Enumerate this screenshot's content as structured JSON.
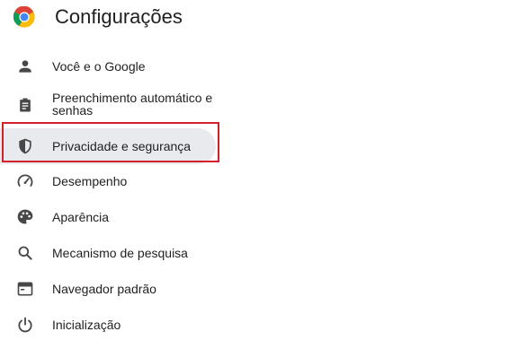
{
  "header": {
    "title": "Configurações",
    "logo_icon": "chrome-logo-icon"
  },
  "sidebar": {
    "items": [
      {
        "label": "Você e o Google",
        "icon": "person-icon"
      },
      {
        "label": "Preenchimento automático e senhas",
        "icon": "clipboard-icon"
      },
      {
        "label": "Privacidade e segurança",
        "icon": "shield-icon",
        "selected": true
      },
      {
        "label": "Desempenho",
        "icon": "speedometer-icon"
      },
      {
        "label": "Aparência",
        "icon": "palette-icon"
      },
      {
        "label": "Mecanismo de pesquisa",
        "icon": "search-icon"
      },
      {
        "label": "Navegador padrão",
        "icon": "browser-window-icon"
      },
      {
        "label": "Inicialização",
        "icon": "power-icon"
      }
    ]
  },
  "colors": {
    "selected_background": "#e8eaed",
    "highlight_border": "#d3202a",
    "text": "#1f1f1f",
    "icon": "#474747"
  }
}
